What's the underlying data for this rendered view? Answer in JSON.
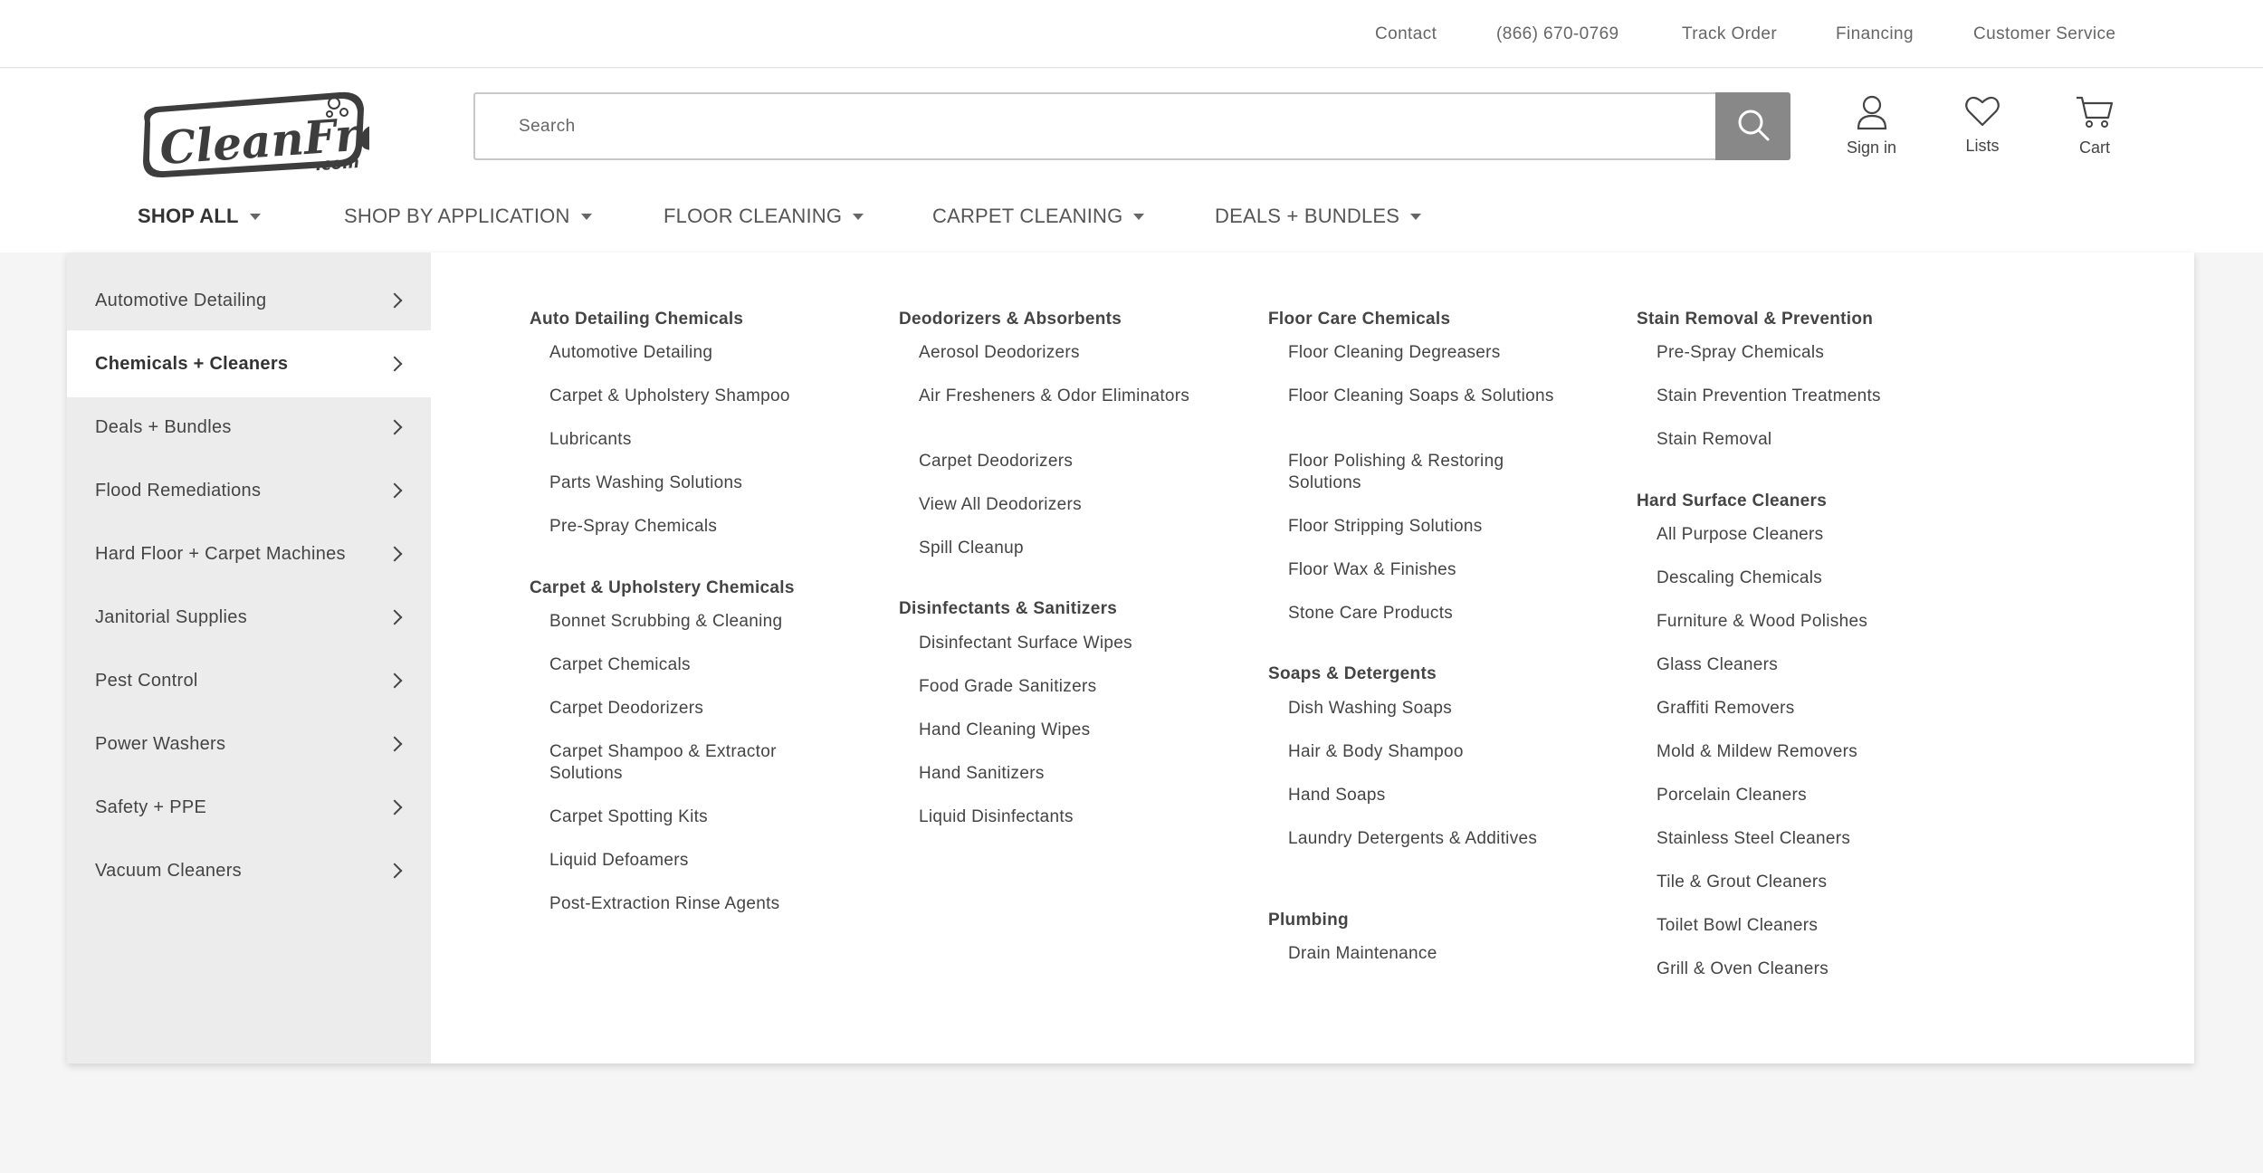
{
  "utility": {
    "contact": "Contact",
    "phone": "(866) 670-0769",
    "track": "Track Order",
    "financing": "Financing",
    "customer_service": "Customer Service"
  },
  "header": {
    "logo_text": "CleanFreak",
    "logo_suffix": ".com",
    "search_placeholder": "Search",
    "sign_in": "Sign in",
    "lists": "Lists",
    "cart": "Cart"
  },
  "nav": [
    "SHOP ALL",
    "SHOP BY APPLICATION",
    "FLOOR CLEANING",
    "CARPET CLEANING",
    "DEALS + BUNDLES"
  ],
  "sidebar": [
    "Automotive Detailing",
    "Chemicals + Cleaners",
    "Deals + Bundles",
    "Flood Remediations",
    "Hard Floor + Carpet Machines",
    "Janitorial Supplies",
    "Pest Control",
    "Power Washers",
    "Safety + PPE",
    "Vacuum Cleaners"
  ],
  "columns": {
    "c1": {
      "h1": "Auto Detailing Chemicals",
      "l1": [
        "Automotive Detailing",
        "Carpet & Upholstery Shampoo",
        "Lubricants",
        "Parts Washing Solutions",
        "Pre-Spray Chemicals"
      ],
      "h2": "Carpet & Upholstery Chemicals",
      "l2": [
        "Bonnet Scrubbing & Cleaning",
        "Carpet Chemicals",
        "Carpet Deodorizers",
        "Carpet Shampoo & Extractor Solutions",
        "Carpet Spotting Kits",
        "Liquid Defoamers",
        "Post-Extraction Rinse Agents"
      ]
    },
    "c2": {
      "h1": "Deodorizers & Absorbents",
      "l1": [
        "Aerosol Deodorizers",
        "Air Fresheners & Odor Eliminators",
        "Carpet Deodorizers",
        "View All Deodorizers",
        "Spill Cleanup"
      ],
      "h2": "Disinfectants & Sanitizers",
      "l2": [
        "Disinfectant Surface Wipes",
        "Food Grade Sanitizers",
        "Hand Cleaning Wipes",
        "Hand Sanitizers",
        "Liquid Disinfectants"
      ]
    },
    "c3": {
      "h1": "Floor Care Chemicals",
      "l1": [
        "Floor Cleaning Degreasers",
        "Floor Cleaning Soaps & Solutions",
        "Floor Polishing & Restoring Solutions",
        "Floor Stripping Solutions",
        "Floor Wax & Finishes",
        "Stone Care Products"
      ],
      "h2": "Soaps & Detergents",
      "l2": [
        "Dish Washing Soaps",
        "Hair & Body Shampoo",
        "Hand Soaps",
        "Laundry Detergents & Additives"
      ],
      "h3": "Plumbing",
      "l3": [
        "Drain Maintenance"
      ]
    },
    "c4": {
      "h1": "Stain Removal & Prevention",
      "l1": [
        "Pre-Spray Chemicals",
        "Stain Prevention Treatments",
        "Stain Removal"
      ],
      "h2": "Hard Surface Cleaners",
      "l2": [
        "All Purpose Cleaners",
        "Descaling Chemicals",
        "Furniture & Wood Polishes",
        "Glass Cleaners",
        "Graffiti Removers",
        "Mold & Mildew Removers",
        "Porcelain Cleaners",
        "Stainless Steel Cleaners",
        "Tile & Grout Cleaners",
        "Toilet Bowl Cleaners",
        "Grill & Oven Cleaners"
      ]
    }
  }
}
